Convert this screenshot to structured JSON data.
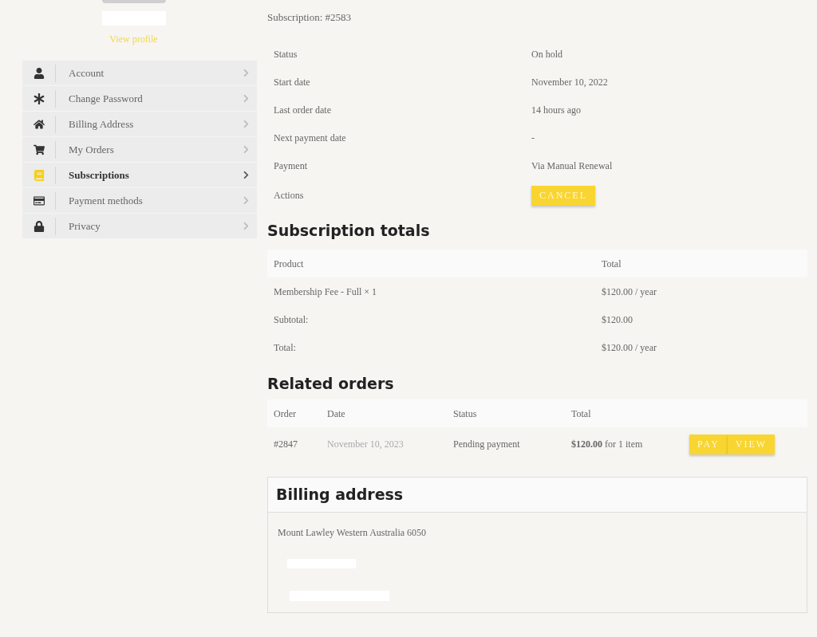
{
  "profile": {
    "link": "View profile"
  },
  "sidebar": {
    "items": [
      {
        "kind": "user",
        "label": "Account",
        "selected": false
      },
      {
        "kind": "asterisk",
        "label": "Change Password",
        "selected": false
      },
      {
        "kind": "home",
        "label": "Billing Address",
        "selected": false
      },
      {
        "kind": "cart",
        "label": "My Orders",
        "selected": false
      },
      {
        "kind": "book",
        "label": "Subscriptions",
        "selected": true
      },
      {
        "kind": "card",
        "label": "Payment methods",
        "selected": false
      },
      {
        "kind": "lock",
        "label": "Privacy",
        "selected": false
      }
    ]
  },
  "subscription": {
    "title": "Subscription: #2583",
    "details": [
      {
        "label": "Status",
        "value": "On hold"
      },
      {
        "label": "Start date",
        "value": "November 10, 2022"
      },
      {
        "label": "Last order date",
        "value": "14 hours ago"
      },
      {
        "label": "Next payment date",
        "value": "-"
      },
      {
        "label": "Payment",
        "value": "Via Manual Renewal"
      }
    ],
    "actions": {
      "label": "Actions",
      "buttons": [
        "CANCEL"
      ]
    }
  },
  "totals": {
    "heading": "Subscription totals",
    "columns": [
      "Product",
      "Total"
    ],
    "rows": [
      {
        "cells": [
          "Membership Fee - Full × 1",
          "$120.00 / year"
        ]
      },
      {
        "cells": [
          "Subtotal:",
          "$120.00"
        ]
      },
      {
        "cells": [
          "Total:",
          "$120.00 / year"
        ]
      }
    ]
  },
  "related_orders": {
    "heading": "Related orders",
    "columns": [
      "Order",
      "Date",
      "Status",
      "Total"
    ],
    "rows": [
      {
        "order": "#2847",
        "date": "November 10, 2023",
        "status": "Pending payment",
        "total": "**$120.00** for 1 item",
        "buttons": [
          "PAY",
          "VIEW"
        ]
      }
    ]
  },
  "billing": {
    "heading": "Billing address",
    "lines": [
      "Mount Lawley Western Australia 6050"
    ]
  }
}
